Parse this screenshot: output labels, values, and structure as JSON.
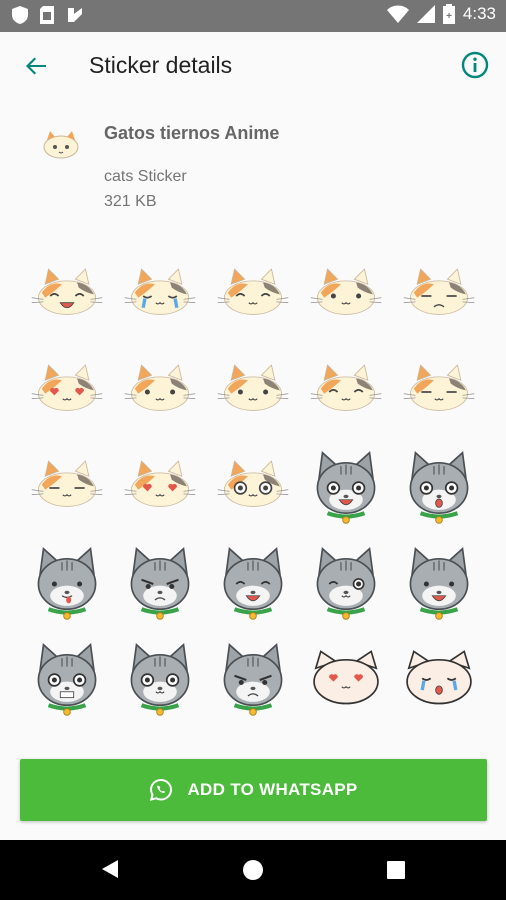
{
  "status_bar": {
    "time": "4:33",
    "icons": [
      "shield-icon",
      "sim-card-icon",
      "notification-icon",
      "wifi-icon",
      "signal-icon",
      "battery-icon"
    ]
  },
  "toolbar": {
    "title": "Sticker details",
    "back_icon": "arrow-back-icon",
    "info_icon": "info-icon",
    "accent_color": "#00897b"
  },
  "pack": {
    "name": "Gatos tiernos Anime",
    "publisher": "cats Sticker",
    "size": "321 KB"
  },
  "stickers": [
    {
      "kind": "calico",
      "mood": "laugh"
    },
    {
      "kind": "calico",
      "mood": "cry"
    },
    {
      "kind": "calico",
      "mood": "giggle"
    },
    {
      "kind": "calico",
      "mood": "surprised"
    },
    {
      "kind": "calico",
      "mood": "sad"
    },
    {
      "kind": "calico",
      "mood": "love"
    },
    {
      "kind": "calico",
      "mood": "sweat"
    },
    {
      "kind": "calico",
      "mood": "blush"
    },
    {
      "kind": "calico",
      "mood": "giggle"
    },
    {
      "kind": "calico",
      "mood": "meh"
    },
    {
      "kind": "calico",
      "mood": "sleepy"
    },
    {
      "kind": "calico",
      "mood": "hearts"
    },
    {
      "kind": "calico",
      "mood": "starry"
    },
    {
      "kind": "grey",
      "mood": "shock"
    },
    {
      "kind": "grey",
      "mood": "gasp"
    },
    {
      "kind": "grey",
      "mood": "tongue"
    },
    {
      "kind": "grey",
      "mood": "angry"
    },
    {
      "kind": "grey",
      "mood": "happy"
    },
    {
      "kind": "grey",
      "mood": "wink"
    },
    {
      "kind": "grey",
      "mood": "grin"
    },
    {
      "kind": "grey",
      "mood": "teeth"
    },
    {
      "kind": "grey",
      "mood": "stare"
    },
    {
      "kind": "grey",
      "mood": "frown"
    },
    {
      "kind": "white",
      "mood": "hearts"
    },
    {
      "kind": "white",
      "mood": "tears"
    }
  ],
  "add_button": {
    "label": "ADD TO WHATSAPP",
    "icon": "whatsapp-icon",
    "color": "#4cbb3c"
  },
  "nav_bar": {
    "icons": [
      "nav-back-icon",
      "nav-home-icon",
      "nav-recents-icon"
    ]
  }
}
